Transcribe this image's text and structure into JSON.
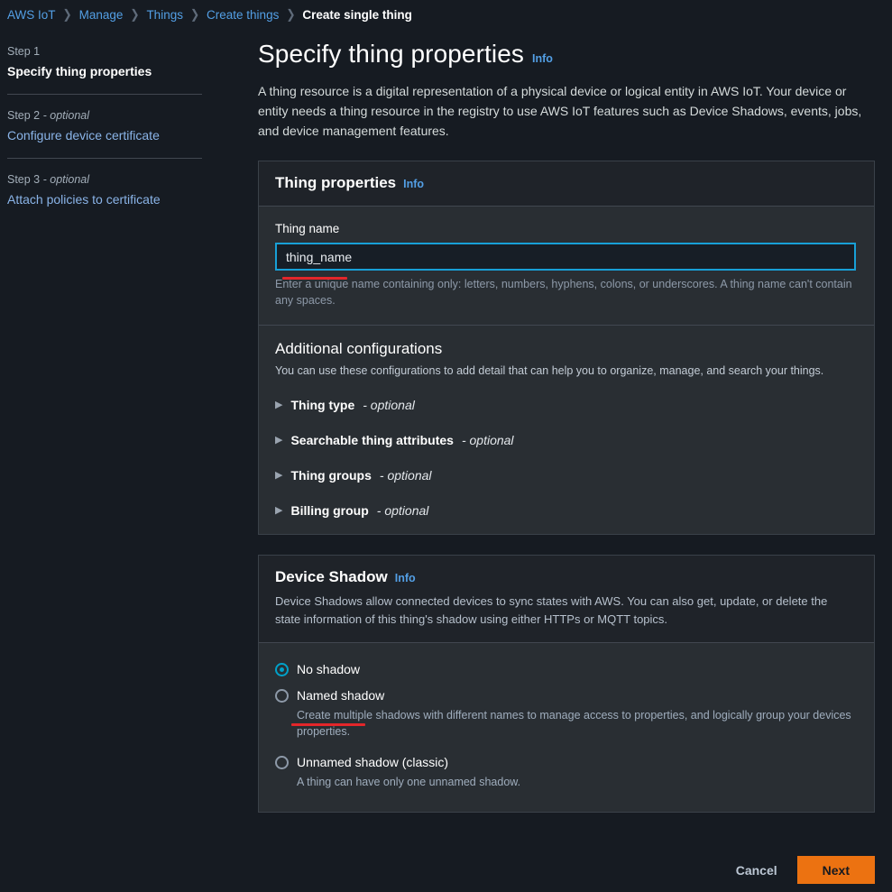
{
  "breadcrumb": {
    "separator": "❯",
    "items": [
      {
        "label": "AWS IoT",
        "current": false
      },
      {
        "label": "Manage",
        "current": false
      },
      {
        "label": "Things",
        "current": false
      },
      {
        "label": "Create things",
        "current": false
      },
      {
        "label": "Create single thing",
        "current": true
      }
    ]
  },
  "wizard": {
    "steps": [
      {
        "number": "Step 1",
        "optional": "",
        "title": "Specify thing properties",
        "active": true
      },
      {
        "number": "Step 2",
        "optional": " - optional",
        "title": "Configure device certificate",
        "active": false
      },
      {
        "number": "Step 3",
        "optional": " - optional",
        "title": "Attach policies to certificate",
        "active": false
      }
    ]
  },
  "page": {
    "title": "Specify thing properties",
    "info_label": "Info",
    "description": "A thing resource is a digital representation of a physical device or logical entity in AWS IoT. Your device or entity needs a thing resource in the registry to use AWS IoT features such as Device Shadows, events, jobs, and device management features."
  },
  "thing_properties": {
    "title": "Thing properties",
    "info_label": "Info",
    "thing_name": {
      "label": "Thing name",
      "value": "thing_name",
      "placeholder": "",
      "helper": "Enter a unique name containing only: letters, numbers, hyphens, colons, or underscores. A thing name can't contain any spaces."
    },
    "additional": {
      "title": "Additional configurations",
      "subtitle": "You can use these configurations to add detail that can help you to organize, manage, and search your things.",
      "expanders": [
        {
          "icon": "triangle-right-icon",
          "marker": "▶",
          "label": "Thing type",
          "optional": " - optional"
        },
        {
          "icon": "triangle-right-icon",
          "marker": "▶",
          "label": "Searchable thing attributes",
          "optional": " - optional"
        },
        {
          "icon": "triangle-right-icon",
          "marker": "▶",
          "label": "Thing groups",
          "optional": " - optional"
        },
        {
          "icon": "triangle-right-icon",
          "marker": "▶",
          "label": "Billing group",
          "optional": " - optional"
        }
      ]
    }
  },
  "device_shadow": {
    "title": "Device Shadow",
    "info_label": "Info",
    "description": "Device Shadows allow connected devices to sync states with AWS. You can also get, update, or delete the state information of this thing's shadow using either HTTPs or MQTT topics.",
    "options": [
      {
        "label": "No shadow",
        "description": "",
        "selected": true
      },
      {
        "label": "Named shadow",
        "description": "Create multiple shadows with different names to manage access to properties, and logically group your devices properties.",
        "selected": false
      },
      {
        "label": "Unnamed shadow (classic)",
        "description": "A thing can have only one unnamed shadow.",
        "selected": false
      }
    ]
  },
  "footer": {
    "cancel_label": "Cancel",
    "next_label": "Next"
  },
  "colors": {
    "accent_link": "#539fe5",
    "accent_cyan": "#00a1c9",
    "focus_border": "#18a0d7",
    "primary_button": "#ec7211",
    "annotation": "#e3262a",
    "page_background": "#161b22",
    "card_background": "#292e33",
    "card_header_background": "#1f2329"
  }
}
